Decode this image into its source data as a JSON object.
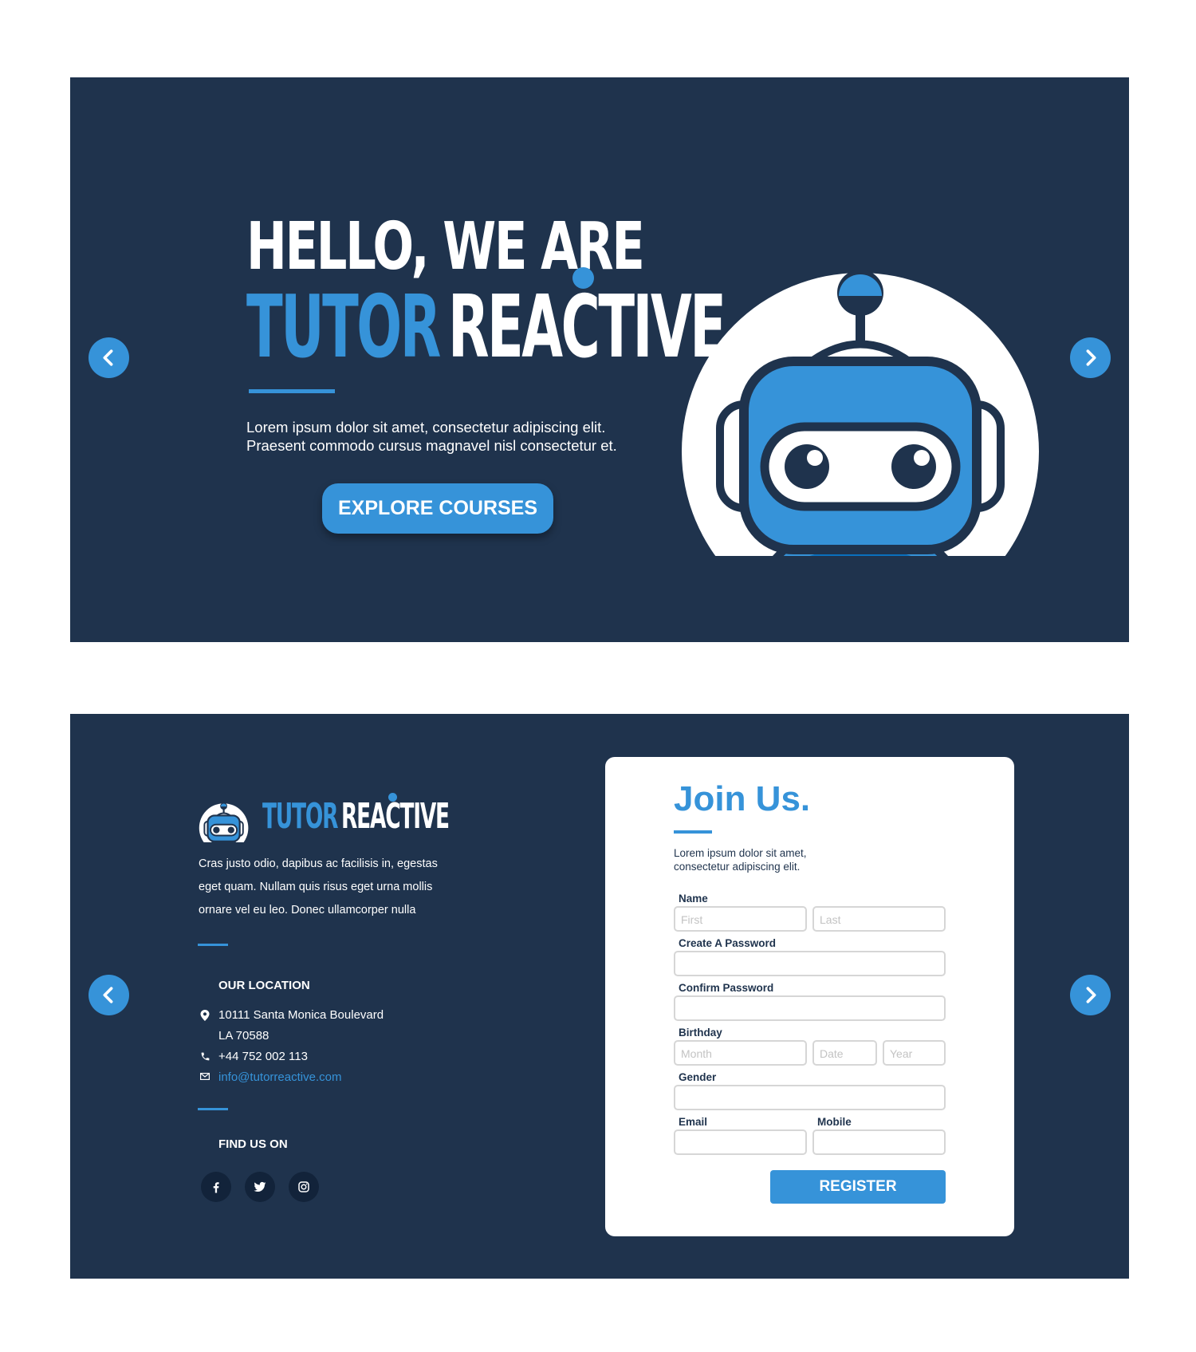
{
  "hero": {
    "greeting": "HELLO, WE ARE",
    "brand_part1": "TUTOR",
    "brand_part2": "REACTIVE",
    "description": "Lorem ipsum dolor sit amet, consectetur adipiscing elit. Praesent commodo cursus magnavel nisl consectetur et.",
    "cta_label": "EXPLORE COURSES"
  },
  "footer": {
    "brand_part1": "TUTOR",
    "brand_part2": "REACTIVE",
    "about": "Cras justo odio, dapibus ac facilisis in, egestas eget quam. Nullam quis risus eget urna mollis ornare vel eu leo. Donec ullamcorper nulla",
    "location_title": "OUR LOCATION",
    "address_line1": "10111 Santa Monica Boulevard",
    "address_line2": "LA 70588",
    "phone": "+44 752 002 113",
    "email": "info@tutorreactive.com",
    "social_title": "FIND US ON",
    "social_icons": [
      "facebook-icon",
      "twitter-icon",
      "instagram-icon"
    ]
  },
  "form": {
    "title": "Join Us.",
    "description": "Lorem ipsum dolor sit amet, consectetur adipiscing elit.",
    "name_label": "Name",
    "first_placeholder": "First",
    "last_placeholder": "Last",
    "password_label": "Create A Password",
    "confirm_label": "Confirm Password",
    "birthday_label": "Birthday",
    "month_placeholder": "Month",
    "date_placeholder": "Date",
    "year_placeholder": "Year",
    "gender_label": "Gender",
    "email_label": "Email",
    "mobile_label": "Mobile",
    "register_label": "REGISTER"
  },
  "colors": {
    "background": "#1f334d",
    "accent": "#3693d9",
    "dark_icon_bg": "#12233a",
    "card": "#ffffff"
  }
}
